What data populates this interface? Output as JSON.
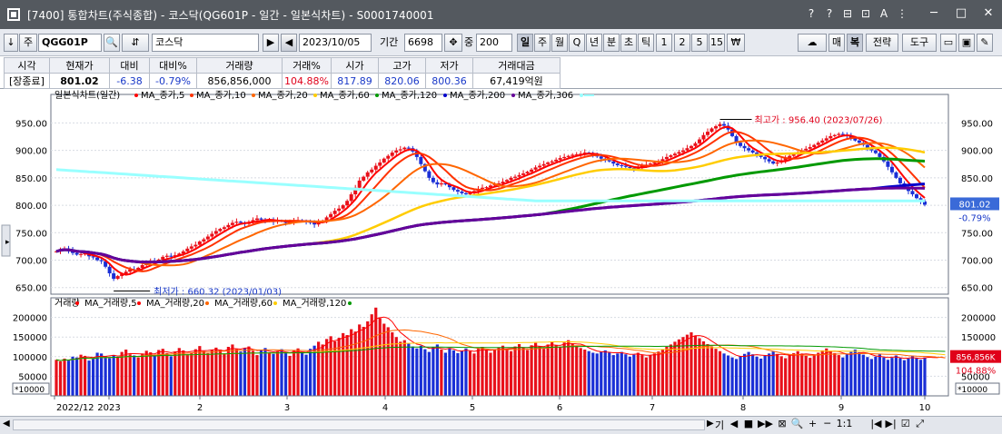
{
  "window": {
    "title": "[7400] 통합차트(주식종합) - 코스닥(QG601P - 일간 - 일본식차트) - S0001740001",
    "header_icons": [
      "help-icon",
      "question-icon",
      "table-icon",
      "dock-icon",
      "font-size-icon",
      "settings-icon"
    ],
    "header_icon_glyphs": [
      "?",
      "?",
      "⊟",
      "⊡",
      "A",
      "⋮"
    ],
    "buttons": {
      "minimize": "─",
      "maximize": "□",
      "close": "✕"
    }
  },
  "toolbar": {
    "down_label": "↓",
    "market_label": "주",
    "code_value": "QGG01P",
    "search_icon": "🔍",
    "list_icon": "⇵",
    "name_value": "코스닥",
    "next_label": "▶",
    "prev_label": "◀",
    "date_value": "2023/10/05",
    "period_label": "기간",
    "period_value": "6698",
    "move_icon": "✥",
    "count_label": "중",
    "count_value": "200",
    "interval_buttons": [
      "일",
      "주",
      "월",
      "Q",
      "년",
      "분",
      "초",
      "틱",
      "1",
      "2",
      "5",
      "15",
      "₩"
    ],
    "right_buttons": [
      "매",
      "복",
      "전략",
      "도구"
    ],
    "right_icons": [
      "folder-icon",
      "save-icon",
      "wrench-icon"
    ],
    "right_icon_glyphs": [
      "▭",
      "▣",
      "✎"
    ]
  },
  "quote": {
    "headers": [
      "시각",
      "현재가",
      "대비",
      "대비%",
      "거래량",
      "거래%",
      "시가",
      "고가",
      "저가",
      "거래대금"
    ],
    "values": [
      "[장종료]",
      "801.02",
      "-6.38",
      "-0.79%",
      "856,856,000",
      "104.88%",
      "817.89",
      "820.06",
      "800.36",
      "67,419억원"
    ],
    "value_colors": [
      "#000000",
      "#000000",
      "#1838c8",
      "#1838c8",
      "#000000",
      "#e0001a",
      "#1838c8",
      "#1838c8",
      "#1838c8",
      "#000000"
    ]
  },
  "chart_data": {
    "type": "candlestick",
    "period": "daily",
    "price_panel": {
      "legend_title": "일본식차트(일간)",
      "legend": [
        {
          "name": "MA_종가,5",
          "color": "#ff0000"
        },
        {
          "name": "MA_종가,10",
          "color": "#ff3300"
        },
        {
          "name": "MA_종가,20",
          "color": "#ff6600"
        },
        {
          "name": "MA_종가,60",
          "color": "#ffcc00"
        },
        {
          "name": "MA_종가,120",
          "color": "#009900"
        },
        {
          "name": "MA_종가,200",
          "color": "#0000cc"
        },
        {
          "name": "MA_종가,306",
          "color": "#660099"
        },
        {
          "name": "",
          "color": "#99ffff"
        }
      ],
      "y_ticks": [
        950,
        900,
        850,
        800,
        750,
        700,
        650
      ],
      "y_tick_labels": [
        "950.00",
        "900.00",
        "850.00",
        "800.00",
        "750.00",
        "700.00",
        "650.00"
      ],
      "ylim": [
        638,
        1002
      ],
      "current_price_label": "801.02",
      "current_change_label": "-0.79%",
      "max_annotation": "최고가 : 956.40 (2023/07/26)",
      "min_annotation": "최저가 : 660.32 (2023/01/03)",
      "max_value": 956.4,
      "min_value": 660.32
    },
    "volume_panel": {
      "legend": [
        {
          "name": "거래량",
          "color": "#ff0000"
        },
        {
          "name": "MA_거래량,5",
          "color": "#ff0000"
        },
        {
          "name": "MA_거래량,20",
          "color": "#ff6600"
        },
        {
          "name": "MA_거래량,60",
          "color": "#ffcc00"
        },
        {
          "name": "MA_거래량,120",
          "color": "#009900"
        }
      ],
      "y_ticks": [
        200000,
        150000,
        100000,
        50000
      ],
      "y_tick_labels": [
        "200000",
        "150000",
        "100000",
        "50000"
      ],
      "ylim": [
        0,
        250000
      ],
      "unit_label": "*10000",
      "current_volume_label": "856,856K",
      "current_volume_pct_label": "104.88%"
    },
    "x_axis_labels": [
      "2022/12",
      "2023",
      "2",
      "3",
      "4",
      "5",
      "6",
      "7",
      "8",
      "9",
      "10"
    ],
    "closes": [
      716,
      720,
      721,
      718,
      713,
      710,
      711,
      712,
      707,
      705,
      700,
      698,
      688,
      676,
      666,
      671,
      675,
      679,
      683,
      681,
      686,
      691,
      695,
      698,
      697,
      701,
      706,
      708,
      707,
      709,
      712,
      716,
      721,
      725,
      728,
      734,
      738,
      743,
      748,
      753,
      757,
      760,
      764,
      768,
      770,
      768,
      766,
      769,
      773,
      776,
      774,
      772,
      773,
      770,
      772,
      771,
      768,
      770,
      772,
      773,
      771,
      770,
      768,
      765,
      769,
      772,
      778,
      784,
      790,
      794,
      800,
      808,
      820,
      832,
      845,
      852,
      860,
      865,
      872,
      878,
      885,
      890,
      896,
      900,
      902,
      905,
      904,
      898,
      888,
      875,
      862,
      850,
      842,
      838,
      840,
      838,
      833,
      828,
      825,
      822,
      820,
      823,
      826,
      830,
      832,
      833,
      836,
      838,
      840,
      843,
      846,
      850,
      852,
      855,
      858,
      861,
      865,
      869,
      872,
      875,
      878,
      880,
      883,
      886,
      888,
      890,
      892,
      893,
      894,
      896,
      895,
      892,
      889,
      885,
      882,
      880,
      876,
      873,
      872,
      870,
      868,
      866,
      869,
      872,
      874,
      876,
      878,
      880,
      884,
      888,
      891,
      894,
      897,
      900,
      904,
      908,
      913,
      920,
      928,
      934,
      940,
      944,
      948,
      945,
      938,
      926,
      914,
      908,
      904,
      900,
      896,
      892,
      888,
      884,
      880,
      876,
      878,
      882,
      886,
      890,
      893,
      896,
      900,
      903,
      906,
      910,
      914,
      918,
      922,
      926,
      928,
      930,
      928,
      926,
      922,
      918,
      914,
      910,
      905,
      900,
      895,
      888,
      880,
      870,
      860,
      850,
      840,
      832,
      826,
      820,
      813,
      807,
      801.02
    ],
    "volumes": [
      92000,
      88000,
      95000,
      90000,
      100000,
      98000,
      105000,
      102000,
      90000,
      95000,
      110000,
      108000,
      101000,
      96000,
      104000,
      99000,
      112000,
      118000,
      106000,
      103000,
      98000,
      108000,
      115000,
      111000,
      104000,
      117000,
      120000,
      109000,
      101000,
      113000,
      122000,
      116000,
      106000,
      110000,
      119000,
      127000,
      114000,
      109000,
      117000,
      123000,
      118000,
      108000,
      125000,
      131000,
      119000,
      113000,
      121000,
      126000,
      115000,
      104000,
      117000,
      122000,
      111000,
      107000,
      114000,
      119000,
      109000,
      102000,
      116000,
      121000,
      113000,
      105000,
      120000,
      128000,
      138000,
      131000,
      145000,
      152000,
      139000,
      148000,
      160000,
      155000,
      170000,
      164000,
      182000,
      176000,
      190000,
      208000,
      225000,
      198000,
      184000,
      175000,
      162000,
      150000,
      138000,
      142000,
      133000,
      126000,
      121000,
      128000,
      119000,
      112000,
      125000,
      131000,
      118000,
      110000,
      122000,
      116000,
      109000,
      115000,
      121000,
      114000,
      108000,
      120000,
      125000,
      117000,
      110000,
      118000,
      123000,
      128000,
      120000,
      114000,
      126000,
      132000,
      124000,
      117000,
      129000,
      135000,
      127000,
      120000,
      131000,
      138000,
      130000,
      124000,
      136000,
      142000,
      133000,
      127000,
      122000,
      118000,
      114000,
      110000,
      108000,
      112000,
      116000,
      110000,
      104000,
      108000,
      112000,
      106000,
      100000,
      105000,
      110000,
      104000,
      98000,
      103000,
      108000,
      113000,
      119000,
      125000,
      131000,
      138000,
      144000,
      150000,
      156000,
      162000,
      154000,
      147000,
      139000,
      132000,
      126000,
      120000,
      114000,
      108000,
      103000,
      98000,
      94000,
      101000,
      107000,
      112000,
      106000,
      100000,
      95000,
      102000,
      108000,
      113000,
      107000,
      101000,
      96000,
      103000,
      109000,
      114000,
      108000,
      102000,
      97000,
      104000,
      110000,
      116000,
      121000,
      115000,
      109000,
      104000,
      98000,
      106000,
      112000,
      118000,
      111000,
      105000,
      99000,
      94000,
      100000,
      106000,
      98000,
      92000,
      97000,
      103000,
      96000,
      91000,
      95000,
      102000,
      97000,
      92000,
      98000,
      104000,
      99000,
      94000,
      100000,
      85685.6
    ]
  },
  "navbar": {
    "icons": [
      "기",
      "◀",
      "■",
      "▶▶",
      "⊠",
      "🔍",
      "+",
      "─",
      "1:1",
      "",
      "|◀",
      "▶|",
      "☑",
      "⤢"
    ],
    "left_arrow": "◀",
    "right_arrow": "▶"
  }
}
